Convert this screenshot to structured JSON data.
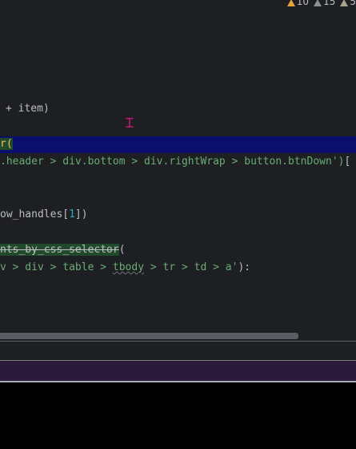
{
  "inspections": {
    "warnings": "10",
    "weak_warnings": "15",
    "typos": "5"
  },
  "code": {
    "line1": "+ item)",
    "line2_tail": "r(",
    "line3_str": ".header > div.bottom > div.rightWrap > button.btnDown')",
    "line3_bracket": "[",
    "line4_a": "ow_handles[",
    "line4_num": "1",
    "line4_b": "])",
    "line5_struck": "nts_by_css_selector",
    "line5_paren": "(",
    "line6_a": "v > div > table > ",
    "line6_wavy": "tbody",
    "line6_b": " > tr > td > a'",
    "line6_end": "):"
  },
  "colors": {
    "selection": "#0b0f6b",
    "string": "#6aab73",
    "number": "#2aacb8",
    "panel_bar": "#2b1a3a"
  }
}
